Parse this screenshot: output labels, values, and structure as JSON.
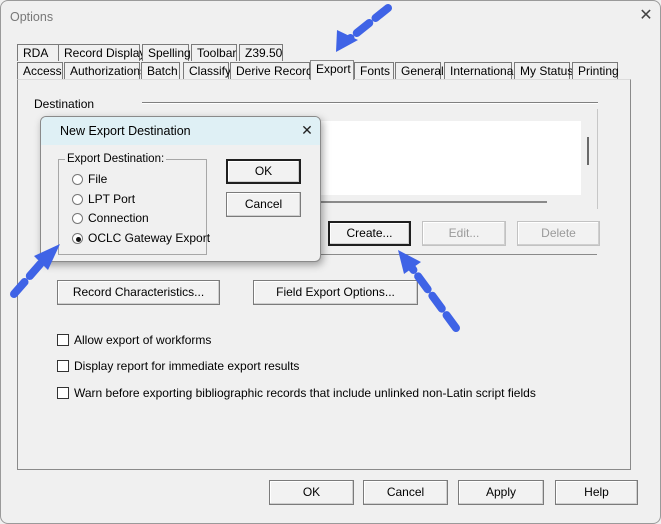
{
  "window": {
    "title": "Options",
    "close_glyph": "✕"
  },
  "tabs_row1": [
    "RDA",
    "Record Display",
    "Spelling",
    "Toolbar",
    "Z39.50"
  ],
  "tabs_row2": [
    "Access",
    "Authorizations",
    "Batch",
    "Classify",
    "Derive Record",
    "Export",
    "Fonts",
    "General",
    "International",
    "My Status",
    "Printing"
  ],
  "active_tab": "Export",
  "destination": {
    "label": "Destination",
    "buttons": {
      "create": "Create...",
      "edit": "Edit...",
      "delete": "Delete"
    }
  },
  "record_characteristics_button": "Record Characteristics...",
  "field_export_options_button": "Field Export Options...",
  "checkboxes": [
    {
      "label": "Allow export of workforms",
      "checked": false
    },
    {
      "label": "Display report for immediate export results",
      "checked": false
    },
    {
      "label": "Warn before exporting bibliographic records that include unlinked non-Latin script fields",
      "checked": false
    }
  ],
  "footer_buttons": {
    "ok": "OK",
    "cancel": "Cancel",
    "apply": "Apply",
    "help": "Help"
  },
  "dialog": {
    "title": "New Export Destination",
    "close_glyph": "✕",
    "group_label": "Export Destination:",
    "options": [
      "File",
      "LPT Port",
      "Connection",
      "OCLC Gateway Export"
    ],
    "selected_option": "OCLC Gateway Export",
    "ok": "OK",
    "cancel": "Cancel"
  },
  "colors": {
    "arrow": "#3f63e6",
    "dialog_title_bg": "#dff0f5",
    "window_bg": "#f0f0f0"
  }
}
